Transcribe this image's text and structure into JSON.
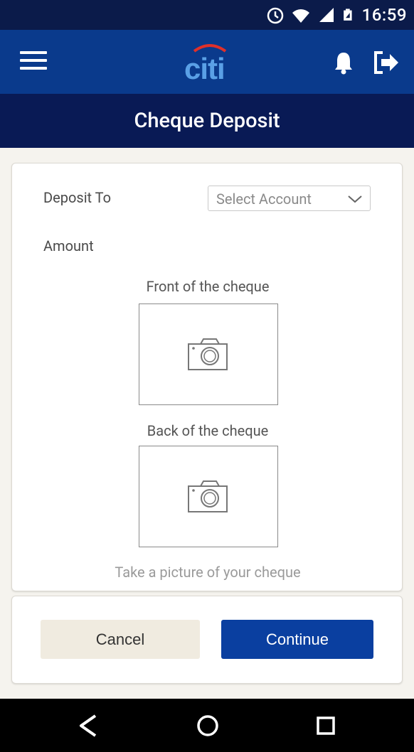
{
  "status_bar": {
    "time": "16:59",
    "icons": [
      "alarm-icon",
      "wifi-icon",
      "signal-icon",
      "battery-icon"
    ]
  },
  "header": {
    "logo_text": "citi",
    "icons": [
      "hamburger-menu-icon",
      "bell-icon",
      "logout-icon"
    ],
    "brand_color": "#0a3a8c"
  },
  "page": {
    "title": "Cheque Deposit"
  },
  "form": {
    "deposit_to_label": "Deposit To",
    "account_select": {
      "value": "Select Account"
    },
    "amount_label": "Amount",
    "front_label": "Front of the cheque",
    "back_label": "Back of the cheque",
    "hint": "Take a picture of your cheque"
  },
  "actions": {
    "cancel_label": "Cancel",
    "continue_label": "Continue",
    "continue_color": "#0a3fa0"
  },
  "nav_bar": {
    "icons": [
      "back-icon",
      "home-icon",
      "recent-apps-icon"
    ]
  }
}
